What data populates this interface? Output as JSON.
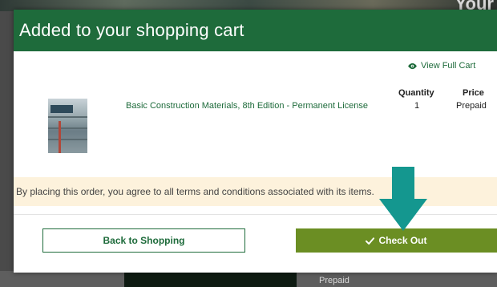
{
  "background": {
    "headline_fragment": "Your",
    "prepaid_text": "Prepaid"
  },
  "modal": {
    "title": "Added to your shopping cart",
    "view_full_cart": "View Full Cart",
    "columns": {
      "quantity": "Quantity",
      "price": "Price"
    },
    "item": {
      "name": "Basic Construction Materials, 8th Edition - Permanent License",
      "quantity": "1",
      "price": "Prepaid",
      "cover_icon": "book-cover-icon"
    },
    "terms": "By placing this order, you agree to all terms and conditions associated with its items.",
    "back_button": "Back to Shopping",
    "checkout_button": "Check Out"
  },
  "colors": {
    "header_green": "#1e6b3b",
    "checkout_green": "#6b8e23",
    "terms_bg": "#fdf2dc",
    "arrow_teal": "#14978f"
  }
}
